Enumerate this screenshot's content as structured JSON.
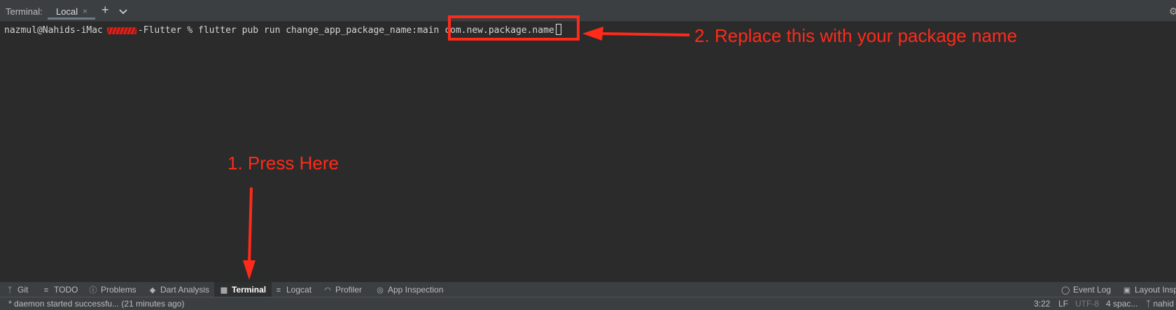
{
  "terminal_tabs": {
    "label": "Terminal:",
    "active_tab": "Local",
    "close_glyph": "×",
    "add_glyph": "+"
  },
  "terminal": {
    "user_host": "nazmul@Nahids-iMac",
    "path_suffix": "-Flutter %",
    "command": "flutter pub run change_app_package_name:main",
    "argument": "com.new.package.name"
  },
  "annotations": {
    "step2": "2. Replace this with your package name",
    "step1": "1. Press Here",
    "color": "#ff2a1a"
  },
  "tool_windows": [
    {
      "label": "Git",
      "icon": "git-branch-icon"
    },
    {
      "label": "TODO",
      "icon": "list-icon"
    },
    {
      "label": "Problems",
      "icon": "info-icon"
    },
    {
      "label": "Dart Analysis",
      "icon": "dart-icon"
    },
    {
      "label": "Terminal",
      "icon": "terminal-icon",
      "active": true
    },
    {
      "label": "Logcat",
      "icon": "logcat-icon"
    },
    {
      "label": "Profiler",
      "icon": "gauge-icon"
    },
    {
      "label": "App Inspection",
      "icon": "inspection-icon"
    }
  ],
  "right_tools": {
    "event_log": "Event Log",
    "layout_inspector": "Layout Insp"
  },
  "status": {
    "message": "* daemon started successfu... (21 minutes ago)",
    "position": "3:22",
    "line_sep": "LF",
    "encoding": "UTF-8",
    "indent": "4 spac...",
    "branch": "nahid"
  }
}
